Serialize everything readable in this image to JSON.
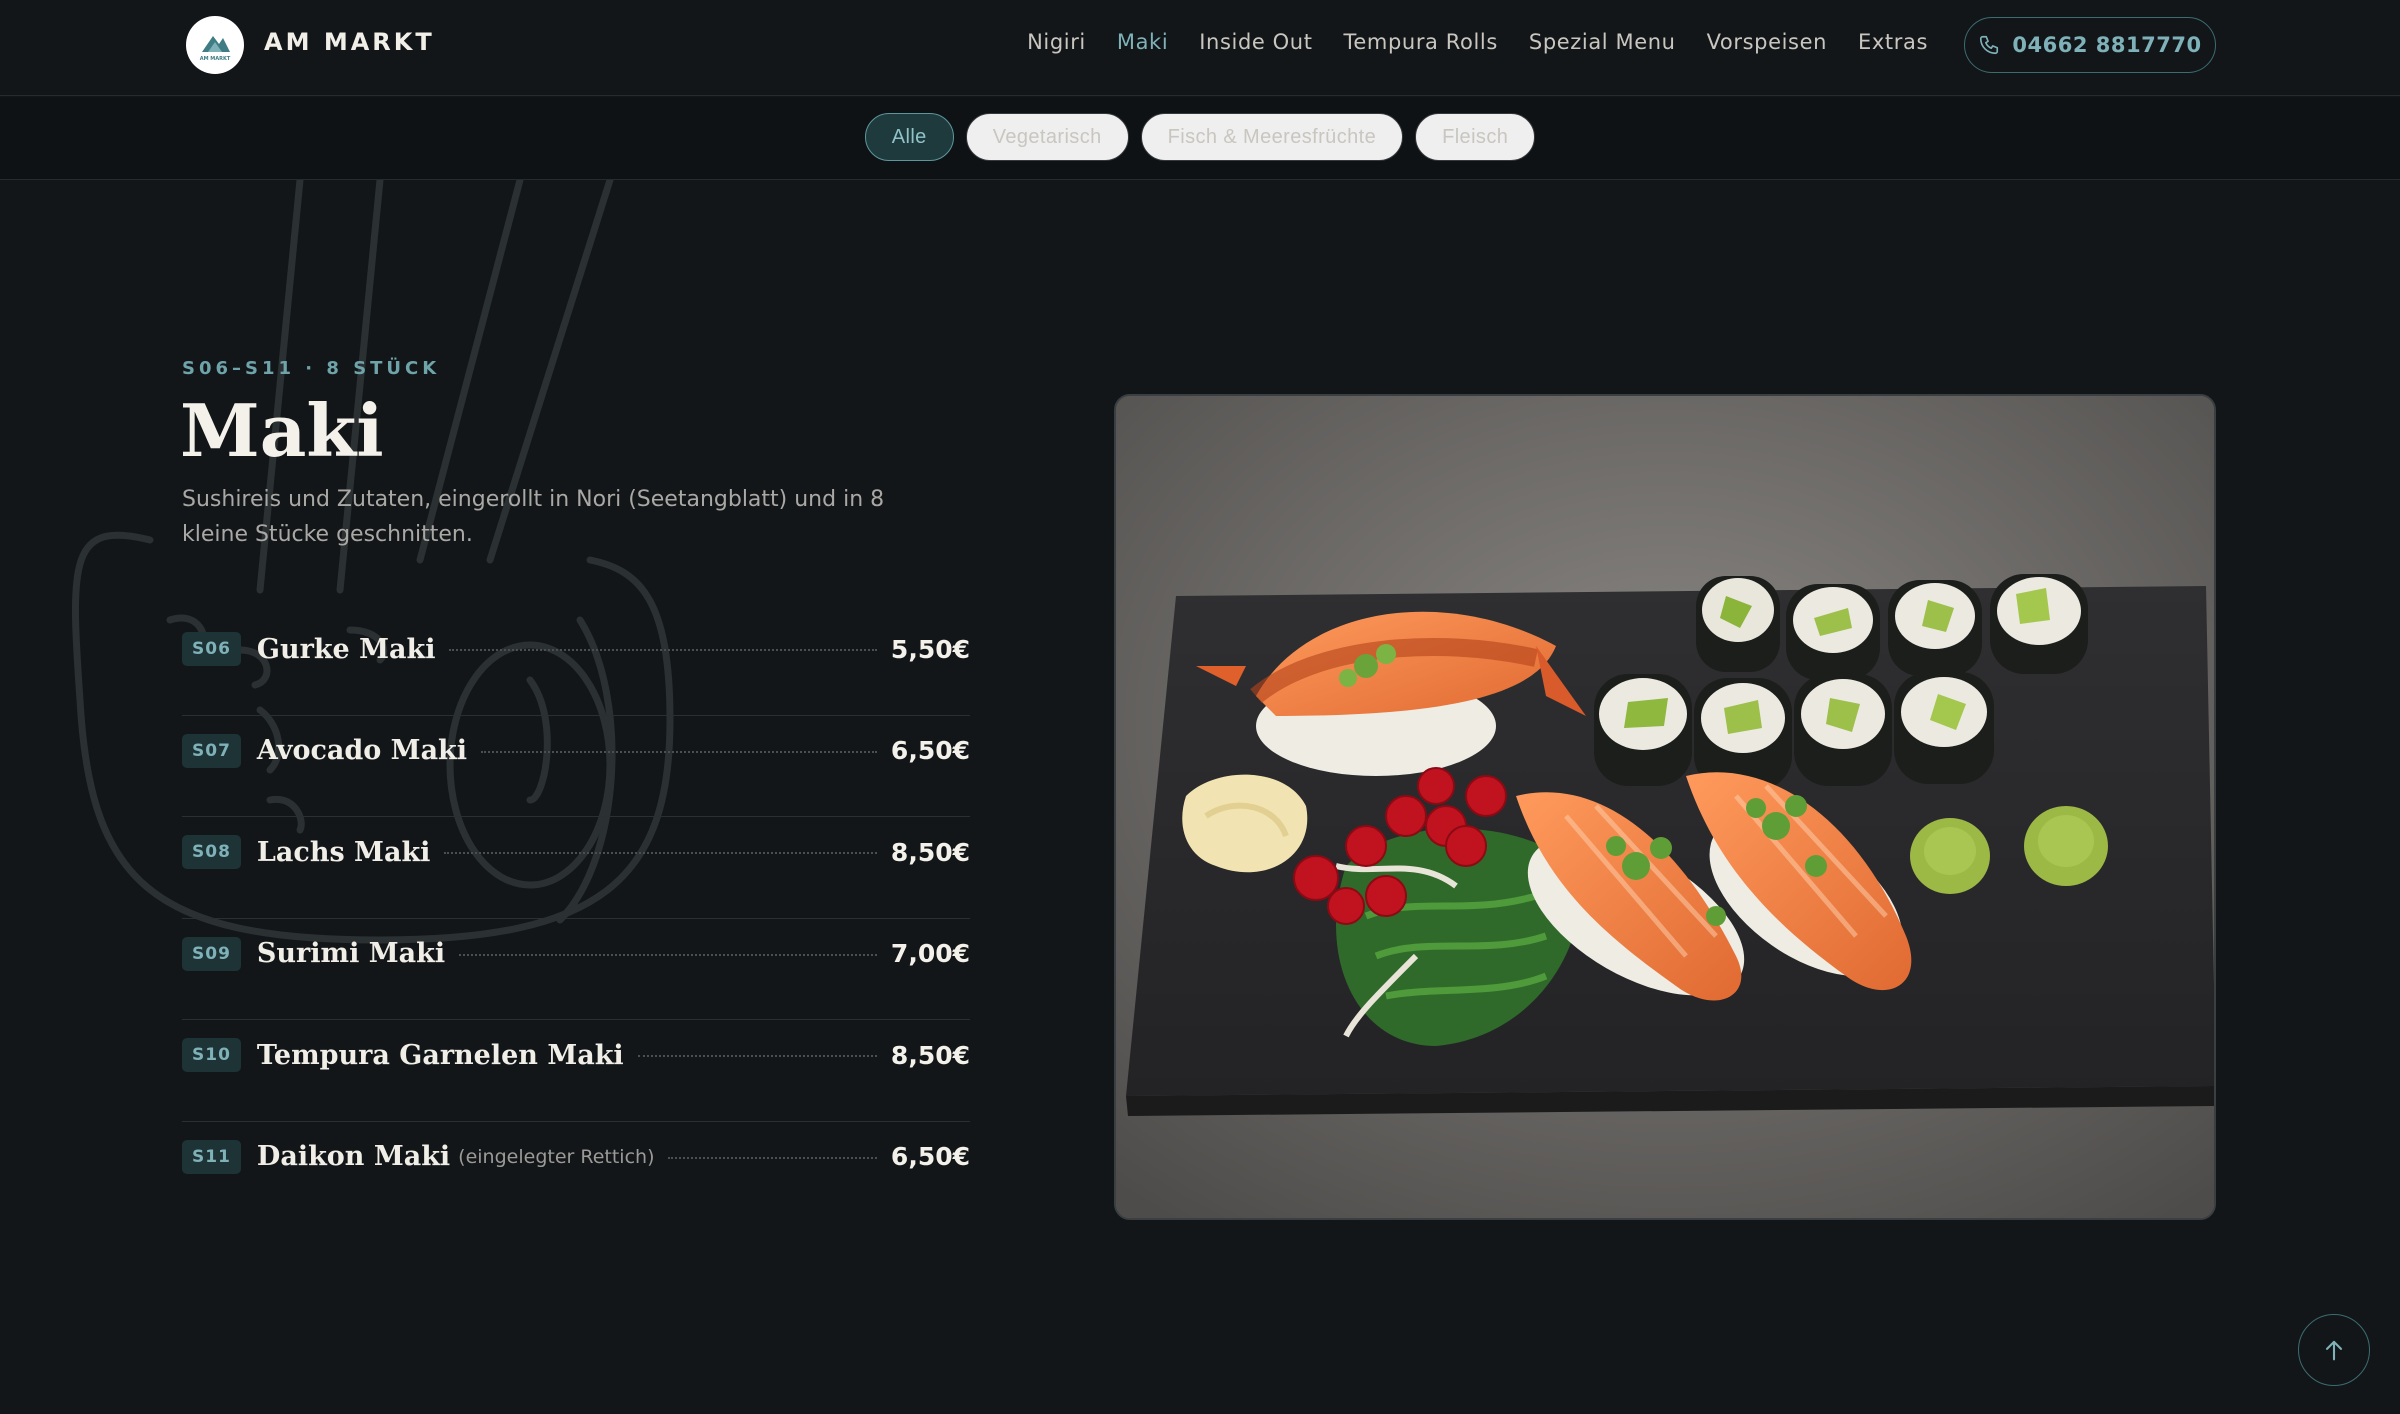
{
  "header": {
    "brand": "AM MARKT",
    "logo_text": "AM MARKT",
    "nav": [
      {
        "label": "Nigiri",
        "active": false
      },
      {
        "label": "Maki",
        "active": true
      },
      {
        "label": "Inside Out",
        "active": false
      },
      {
        "label": "Tempura Rolls",
        "active": false
      },
      {
        "label": "Spezial Menu",
        "active": false
      },
      {
        "label": "Vorspeisen",
        "active": false
      },
      {
        "label": "Extras",
        "active": false
      }
    ],
    "phone": "04662 8817770"
  },
  "filters": [
    {
      "label": "Alle",
      "active": true
    },
    {
      "label": "Vegetarisch",
      "active": false
    },
    {
      "label": "Fisch & Meeresfrüchte",
      "active": false
    },
    {
      "label": "Fleisch",
      "active": false
    }
  ],
  "section": {
    "eyebrow": "S06–S11 · 8 STÜCK",
    "title": "Maki",
    "description": "Sushireis und Zutaten, eingerollt in Nori (Seetangblatt) und in 8 kleine Stücke geschnitten."
  },
  "items": [
    {
      "code": "S06",
      "name": "Gurke Maki",
      "note": "",
      "price": "5,50€"
    },
    {
      "code": "S07",
      "name": "Avocado Maki",
      "note": "",
      "price": "6,50€"
    },
    {
      "code": "S08",
      "name": "Lachs Maki",
      "note": "",
      "price": "8,50€"
    },
    {
      "code": "S09",
      "name": "Surimi Maki",
      "note": "",
      "price": "7,00€"
    },
    {
      "code": "S10",
      "name": "Tempura Garnelen Maki",
      "note": "",
      "price": "8,50€"
    },
    {
      "code": "S11",
      "name": "Daikon Maki",
      "note": "(eingelegter Rettich)",
      "price": "6,50€"
    }
  ],
  "colors": {
    "background": "#121619",
    "accent": "#7fb1b8",
    "accent_border": "#3b6c72"
  },
  "icons": {
    "phone": "phone-icon",
    "scroll_top": "arrow-up-icon"
  }
}
